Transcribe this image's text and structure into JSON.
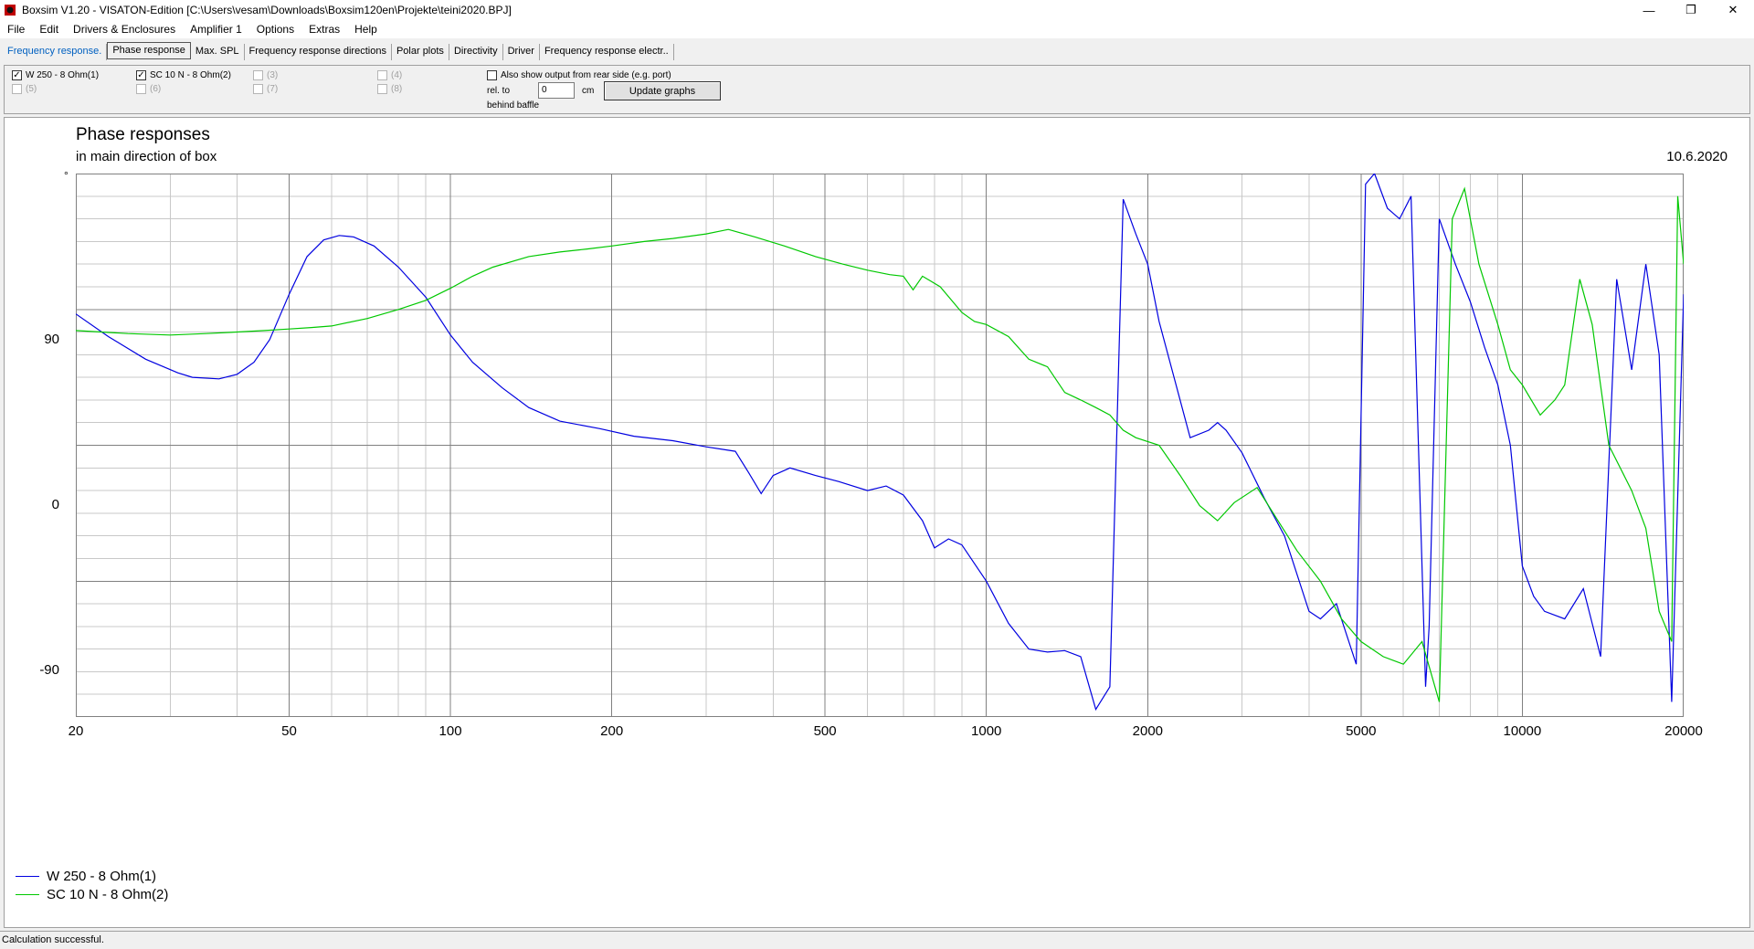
{
  "window": {
    "title": "Boxsim V1.20 - VISATON-Edition [C:\\Users\\vesam\\Downloads\\Boxsim120en\\Projekte\\teini2020.BPJ]",
    "minimize": "—",
    "maximize": "❐",
    "close": "✕"
  },
  "menu": [
    "File",
    "Edit",
    "Drivers & Enclosures",
    "Amplifier 1",
    "Options",
    "Extras",
    "Help"
  ],
  "tabs": [
    "Frequency response.",
    "Phase response",
    "Max. SPL",
    "Frequency response directions",
    "Polar plots",
    "Directivity",
    "Driver",
    "Frequency response electr.."
  ],
  "active_tab": "Phase response",
  "options": {
    "drivers": [
      {
        "label": "W 250 - 8 Ohm(1)",
        "checked": true,
        "enabled": true
      },
      {
        "label": "SC 10 N - 8 Ohm(2)",
        "checked": true,
        "enabled": true
      },
      {
        "label": "(3)",
        "checked": false,
        "enabled": false
      },
      {
        "label": "(4)",
        "checked": false,
        "enabled": false
      },
      {
        "label": "(5)",
        "checked": false,
        "enabled": false
      },
      {
        "label": "(6)",
        "checked": false,
        "enabled": false
      },
      {
        "label": "(7)",
        "checked": false,
        "enabled": false
      },
      {
        "label": "(8)",
        "checked": false,
        "enabled": false
      }
    ],
    "rear_output_label": "Also show output from rear side (e.g. port)",
    "rel_to_label": "rel. to",
    "behind_baffle_label": "behind baffle",
    "distance_value": "0",
    "unit_label": "cm",
    "update_button": "Update graphs"
  },
  "chart": {
    "title": "Phase responses",
    "subtitle": "in main direction of box",
    "date": "10.6.2020",
    "y_unit": "°",
    "y_tick_labels": [
      "90",
      "0",
      "-90"
    ],
    "x_tick_labels": [
      "20",
      "50",
      "100",
      "200",
      "500",
      "1000",
      "2000",
      "5000",
      "10000",
      "20000"
    ]
  },
  "chart_data": {
    "type": "line",
    "title": "Phase responses",
    "subtitle": "in main direction of box",
    "x_scale": "log",
    "xlim": [
      20,
      20000
    ],
    "ylim": [
      -180,
      180
    ],
    "y_ticks": [
      90,
      0,
      -90
    ],
    "x_ticks": [
      20,
      50,
      100,
      200,
      500,
      1000,
      2000,
      5000,
      10000,
      20000
    ],
    "grid": true,
    "legend_position": "bottom-left",
    "series": [
      {
        "name": "W 250 - 8 Ohm(1)",
        "color": "#0000e0",
        "points": [
          [
            20,
            87
          ],
          [
            23,
            72
          ],
          [
            27,
            57
          ],
          [
            31,
            48
          ],
          [
            33,
            45
          ],
          [
            37,
            44
          ],
          [
            40,
            47
          ],
          [
            43,
            55
          ],
          [
            46,
            70
          ],
          [
            50,
            100
          ],
          [
            54,
            125
          ],
          [
            58,
            136
          ],
          [
            62,
            139
          ],
          [
            66,
            138
          ],
          [
            72,
            132
          ],
          [
            80,
            118
          ],
          [
            90,
            98
          ],
          [
            100,
            73
          ],
          [
            110,
            55
          ],
          [
            125,
            38
          ],
          [
            140,
            25
          ],
          [
            160,
            16
          ],
          [
            190,
            11
          ],
          [
            220,
            6
          ],
          [
            260,
            3
          ],
          [
            300,
            -1
          ],
          [
            340,
            -4
          ],
          [
            360,
            -18
          ],
          [
            380,
            -32
          ],
          [
            400,
            -20
          ],
          [
            430,
            -15
          ],
          [
            480,
            -20
          ],
          [
            530,
            -24
          ],
          [
            600,
            -30
          ],
          [
            650,
            -27
          ],
          [
            700,
            -33
          ],
          [
            760,
            -50
          ],
          [
            800,
            -68
          ],
          [
            850,
            -62
          ],
          [
            900,
            -66
          ],
          [
            1000,
            -90
          ],
          [
            1100,
            -118
          ],
          [
            1200,
            -135
          ],
          [
            1300,
            -137
          ],
          [
            1400,
            -136
          ],
          [
            1500,
            -140
          ],
          [
            1600,
            -175
          ],
          [
            1700,
            -160
          ],
          [
            1800,
            163
          ],
          [
            1900,
            140
          ],
          [
            2000,
            120
          ],
          [
            2100,
            82
          ],
          [
            2400,
            5
          ],
          [
            2600,
            10
          ],
          [
            2700,
            15
          ],
          [
            2800,
            10
          ],
          [
            3000,
            -5
          ],
          [
            3300,
            -35
          ],
          [
            3600,
            -60
          ],
          [
            4000,
            -110
          ],
          [
            4200,
            -115
          ],
          [
            4500,
            -105
          ],
          [
            4900,
            -145
          ],
          [
            5100,
            173
          ],
          [
            5300,
            180
          ],
          [
            5600,
            157
          ],
          [
            5900,
            150
          ],
          [
            6200,
            165
          ],
          [
            6600,
            -160
          ],
          [
            6700,
            -120
          ],
          [
            7000,
            150
          ],
          [
            7500,
            120
          ],
          [
            8000,
            95
          ],
          [
            8500,
            65
          ],
          [
            9000,
            40
          ],
          [
            9500,
            0
          ],
          [
            10000,
            -80
          ],
          [
            10500,
            -100
          ],
          [
            11000,
            -110
          ],
          [
            12000,
            -115
          ],
          [
            13000,
            -95
          ],
          [
            14000,
            -140
          ],
          [
            15000,
            110
          ],
          [
            16000,
            50
          ],
          [
            17000,
            120
          ],
          [
            18000,
            60
          ],
          [
            19000,
            -170
          ],
          [
            20000,
            100
          ]
        ]
      },
      {
        "name": "SC 10 N - 8 Ohm(2)",
        "color": "#00c800",
        "points": [
          [
            20,
            76
          ],
          [
            25,
            74
          ],
          [
            30,
            73
          ],
          [
            35,
            74
          ],
          [
            40,
            75
          ],
          [
            45,
            76
          ],
          [
            50,
            77
          ],
          [
            55,
            78
          ],
          [
            60,
            79
          ],
          [
            70,
            84
          ],
          [
            80,
            90
          ],
          [
            90,
            96
          ],
          [
            100,
            104
          ],
          [
            110,
            112
          ],
          [
            120,
            118
          ],
          [
            140,
            125
          ],
          [
            160,
            128
          ],
          [
            180,
            130
          ],
          [
            200,
            132
          ],
          [
            230,
            135
          ],
          [
            260,
            137
          ],
          [
            300,
            140
          ],
          [
            330,
            143
          ],
          [
            370,
            138
          ],
          [
            420,
            132
          ],
          [
            480,
            125
          ],
          [
            540,
            120
          ],
          [
            600,
            116
          ],
          [
            660,
            113
          ],
          [
            700,
            112
          ],
          [
            730,
            103
          ],
          [
            760,
            112
          ],
          [
            820,
            105
          ],
          [
            900,
            88
          ],
          [
            950,
            82
          ],
          [
            1000,
            80
          ],
          [
            1100,
            72
          ],
          [
            1200,
            57
          ],
          [
            1300,
            52
          ],
          [
            1400,
            35
          ],
          [
            1500,
            30
          ],
          [
            1600,
            25
          ],
          [
            1700,
            20
          ],
          [
            1800,
            10
          ],
          [
            1900,
            5
          ],
          [
            2100,
            0
          ],
          [
            2300,
            -20
          ],
          [
            2500,
            -40
          ],
          [
            2700,
            -50
          ],
          [
            2900,
            -38
          ],
          [
            3200,
            -28
          ],
          [
            3500,
            -50
          ],
          [
            3800,
            -70
          ],
          [
            4200,
            -90
          ],
          [
            4600,
            -115
          ],
          [
            5000,
            -130
          ],
          [
            5500,
            -140
          ],
          [
            6000,
            -145
          ],
          [
            6500,
            -130
          ],
          [
            7000,
            -170
          ],
          [
            7400,
            150
          ],
          [
            7800,
            170
          ],
          [
            8300,
            120
          ],
          [
            9000,
            80
          ],
          [
            9500,
            50
          ],
          [
            10000,
            40
          ],
          [
            10800,
            20
          ],
          [
            11500,
            30
          ],
          [
            12000,
            40
          ],
          [
            12800,
            110
          ],
          [
            13500,
            80
          ],
          [
            14500,
            0
          ],
          [
            16000,
            -30
          ],
          [
            17000,
            -55
          ],
          [
            18000,
            -110
          ],
          [
            19000,
            -130
          ],
          [
            19500,
            165
          ],
          [
            20000,
            120
          ]
        ]
      }
    ]
  },
  "status": "Calculation successful."
}
